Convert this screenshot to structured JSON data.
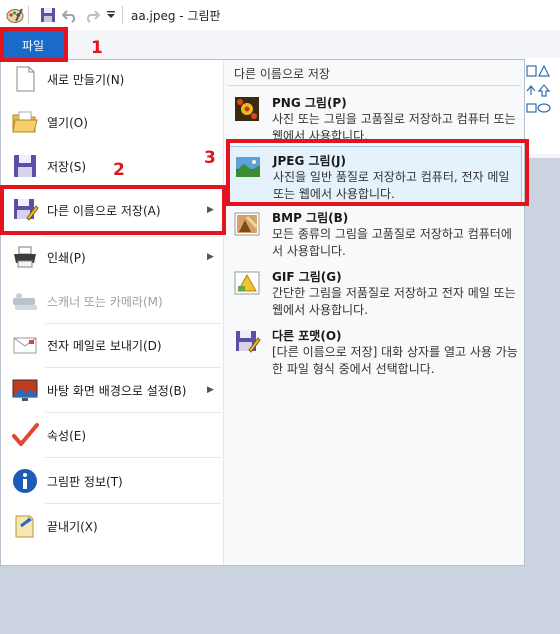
{
  "window": {
    "title": "aa.jpeg - 그림판"
  },
  "file_tab": {
    "label": "파일"
  },
  "left_menu": [
    {
      "label": "새로 만들기(N)",
      "icon": "new-document-icon",
      "submenu": false,
      "disabled": false
    },
    {
      "label": "열기(O)",
      "icon": "open-folder-icon",
      "submenu": false,
      "disabled": false
    },
    {
      "label": "저장(S)",
      "icon": "save-disk-icon",
      "submenu": false,
      "disabled": false
    },
    {
      "label": "다른 이름으로 저장(A)",
      "icon": "save-as-icon",
      "submenu": true,
      "disabled": false
    },
    {
      "label": "인쇄(P)",
      "icon": "printer-icon",
      "submenu": true,
      "disabled": false
    },
    {
      "label": "스캐너 또는 카메라(M)",
      "icon": "scanner-icon",
      "submenu": false,
      "disabled": true
    },
    {
      "label": "전자 메일로 보내기(D)",
      "icon": "email-icon",
      "submenu": false,
      "disabled": false
    },
    {
      "label": "바탕 화면 배경으로 설정(B)",
      "icon": "desktop-background-icon",
      "submenu": true,
      "disabled": false
    },
    {
      "label": "속성(E)",
      "icon": "properties-checkmark-icon",
      "submenu": false,
      "disabled": false
    },
    {
      "label": "그림판 정보(T)",
      "icon": "info-icon",
      "submenu": false,
      "disabled": false
    },
    {
      "label": "끝내기(X)",
      "icon": "exit-icon",
      "submenu": false,
      "disabled": false
    }
  ],
  "save_as": {
    "header": "다른 이름으로 저장",
    "items": [
      {
        "title": "PNG 그림(P)",
        "desc": "사진 또는 그림을 고품질로 저장하고 컴퓨터 또는 웹에서 사용합니다.",
        "icon": "png-image-icon",
        "highlighted": false
      },
      {
        "title": "JPEG 그림(J)",
        "desc": "사진을 일반 품질로 저장하고 컴퓨터, 전자 메일 또는 웹에서 사용합니다.",
        "icon": "jpeg-image-icon",
        "highlighted": true
      },
      {
        "title": "BMP 그림(B)",
        "desc": "모든 종류의 그림을 고품질로 저장하고 컴퓨터에서 사용합니다.",
        "icon": "bmp-image-icon",
        "highlighted": false
      },
      {
        "title": "GIF 그림(G)",
        "desc": "간단한 그림을 저품질로 저장하고 전자 메일 또는 웹에서 사용합니다.",
        "icon": "gif-image-icon",
        "highlighted": false
      },
      {
        "title": "다른 포맷(O)",
        "desc": "[다른 이름으로 저장] 대화 상자를 열고 사용 가능한 파일 형식 중에서 선택합니다.",
        "icon": "other-format-icon",
        "highlighted": false
      }
    ]
  },
  "annotations": {
    "step1": "1",
    "step2": "2",
    "step3": "3"
  },
  "colors": {
    "accent": "#1a6bc9",
    "highlight": "#e3141e"
  }
}
